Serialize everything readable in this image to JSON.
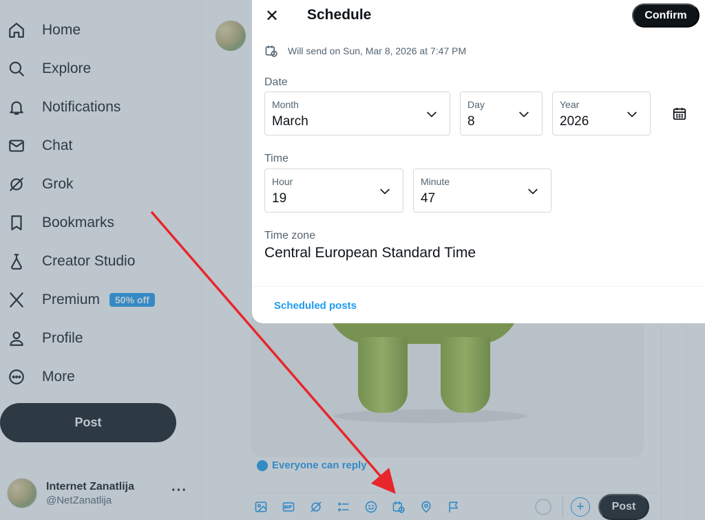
{
  "sidebar": {
    "items": [
      {
        "label": "Home",
        "icon": "home-icon"
      },
      {
        "label": "Explore",
        "icon": "search-icon"
      },
      {
        "label": "Notifications",
        "icon": "bell-icon"
      },
      {
        "label": "Chat",
        "icon": "mail-icon"
      },
      {
        "label": "Grok",
        "icon": "grok-icon"
      },
      {
        "label": "Bookmarks",
        "icon": "bookmark-icon"
      },
      {
        "label": "Creator Studio",
        "icon": "flask-icon"
      },
      {
        "label": "Premium",
        "icon": "x-logo-icon",
        "badge": "50% off"
      },
      {
        "label": "Profile",
        "icon": "person-icon"
      },
      {
        "label": "More",
        "icon": "more-circle-icon"
      }
    ],
    "post_label": "Post",
    "account": {
      "name": "Internet Zanatlija",
      "handle": "@NetZanatlija",
      "more": "···"
    }
  },
  "composer": {
    "reply_setting": "Everyone can reply",
    "post_label": "Post",
    "toolbar_icons": [
      "image-icon",
      "gif-icon",
      "grok-icon",
      "poll-icon",
      "emoji-icon",
      "schedule-icon",
      "location-icon",
      "flag-icon"
    ]
  },
  "modal": {
    "title": "Schedule",
    "confirm_label": "Confirm",
    "will_send": "Will send on Sun, Mar 8, 2026 at 7:47 PM",
    "date_label": "Date",
    "month": {
      "label": "Month",
      "value": "March"
    },
    "day": {
      "label": "Day",
      "value": "8"
    },
    "year": {
      "label": "Year",
      "value": "2026"
    },
    "time_label": "Time",
    "hour": {
      "label": "Hour",
      "value": "19"
    },
    "minute": {
      "label": "Minute",
      "value": "47"
    },
    "timezone_label": "Time zone",
    "timezone_value": "Central European Standard Time",
    "scheduled_posts_link": "Scheduled posts"
  },
  "colors": {
    "accent": "#1d9bf0",
    "text": "#0f1419",
    "muted": "#536471",
    "annotation_arrow": "#e8262b"
  }
}
